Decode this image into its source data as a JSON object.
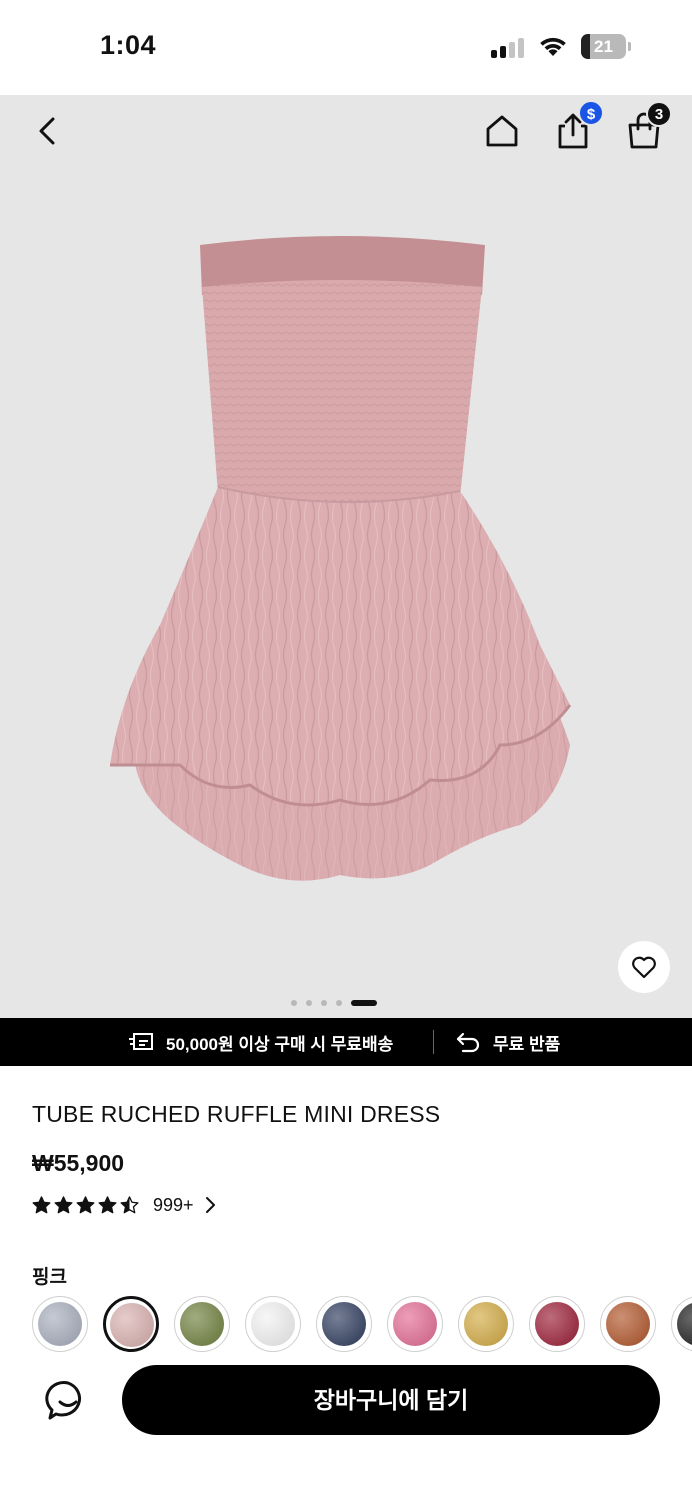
{
  "status_bar": {
    "time": "1:04",
    "battery_level": "21",
    "battery_fraction": 0.21,
    "signal_bars": 2
  },
  "header": {
    "back_icon": "chevron-left-icon",
    "home_icon": "home-icon",
    "share_icon": "share-icon",
    "share_badge": "$",
    "share_badge_color": "#1a55e6",
    "bag_icon": "shopping-bag-icon",
    "cart_count": "3"
  },
  "gallery": {
    "background": "#e6e6e6",
    "image_count": 5,
    "active_index": 4,
    "wishlist_icon": "heart-icon"
  },
  "promo": {
    "shipping_icon": "fast-delivery-icon",
    "shipping_text": "50,000원 이상 구매 시 무료배송",
    "return_icon": "return-arrow-icon",
    "return_text": "무료 반품"
  },
  "product": {
    "title": "TUBE RUCHED RUFFLE MINI DRESS",
    "price": "₩55,900",
    "rating_stars": 4.5,
    "rating_count": "999+",
    "selected_color": "핑크"
  },
  "swatches": [
    {
      "name": "gray-blue",
      "color": "#a6adbc",
      "selected": false
    },
    {
      "name": "pink",
      "color": "#d8b0ae",
      "selected": true
    },
    {
      "name": "olive",
      "color": "#6e7f3c",
      "selected": false
    },
    {
      "name": "white",
      "color": "#f2f2f2",
      "selected": false
    },
    {
      "name": "navy",
      "color": "#2c3a5c",
      "selected": false
    },
    {
      "name": "hot-pink",
      "color": "#e36a94",
      "selected": false
    },
    {
      "name": "mustard",
      "color": "#d2aa42",
      "selected": false
    },
    {
      "name": "burgundy",
      "color": "#9a1c34",
      "selected": false
    },
    {
      "name": "rust",
      "color": "#b05428",
      "selected": false
    },
    {
      "name": "black",
      "color": "#1a1a1a",
      "selected": false
    }
  ],
  "actions": {
    "chat_icon": "chat-bubble-smile-icon",
    "add_to_cart_label": "장바구니에 담기"
  }
}
